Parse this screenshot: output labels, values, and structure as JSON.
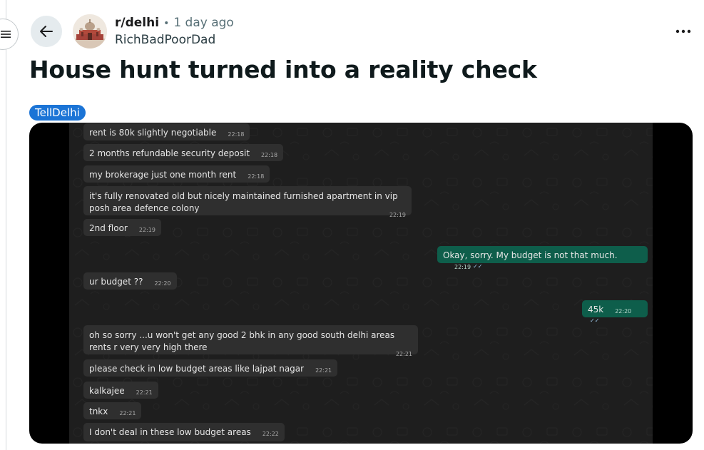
{
  "post": {
    "subreddit": "r/delhi",
    "separator": "•",
    "age": "1 day ago",
    "author": "RichBadPoorDad",
    "title": "House hunt turned into a reality check",
    "flair": "TellDelhi"
  },
  "icons": {
    "menu": "hamburger-menu-icon",
    "back": "arrow-left-icon",
    "more": "more-options-icon",
    "read_receipt": "double-check-icon"
  },
  "colors": {
    "flair_bg": "#1b74d6",
    "chat_bg": "#1e1e1e",
    "incoming_bubble": "#2f2f2f",
    "outgoing_bubble": "#0e5e4b"
  },
  "chat": {
    "messages": [
      {
        "dir": "in",
        "text": "rent is 80k  slightly negotiable",
        "time": "22:18"
      },
      {
        "dir": "in",
        "text": "2 months refundable security deposit",
        "time": "22:18"
      },
      {
        "dir": "in",
        "text": "my brokerage just one month rent",
        "time": "22:18"
      },
      {
        "dir": "in",
        "text": "it's fully renovated old but nicely maintained  furnished apartment  in vip posh area defence colony",
        "time": "22:19"
      },
      {
        "dir": "in",
        "text": "2nd floor",
        "time": "22:19"
      },
      {
        "dir": "out",
        "text": "Okay, sorry. My budget is not that much.",
        "time": "22:19"
      },
      {
        "dir": "in",
        "text": "ur budget ??",
        "time": "22:20"
      },
      {
        "dir": "out",
        "text": "45k",
        "time": "22:20"
      },
      {
        "dir": "in",
        "text": "oh  so sorry ...u won't get any good 2 bhk in any good south delhi areas   rents r very very high there",
        "time": "22:21"
      },
      {
        "dir": "in",
        "text": "please check in low budget areas like lajpat nagar",
        "time": "22:21"
      },
      {
        "dir": "in",
        "text": "kalkajee",
        "time": "22:21"
      },
      {
        "dir": "in",
        "text": "tnkx",
        "time": "22:21"
      },
      {
        "dir": "in",
        "text": "I don't deal in these low budget areas",
        "time": "22:22"
      }
    ]
  }
}
